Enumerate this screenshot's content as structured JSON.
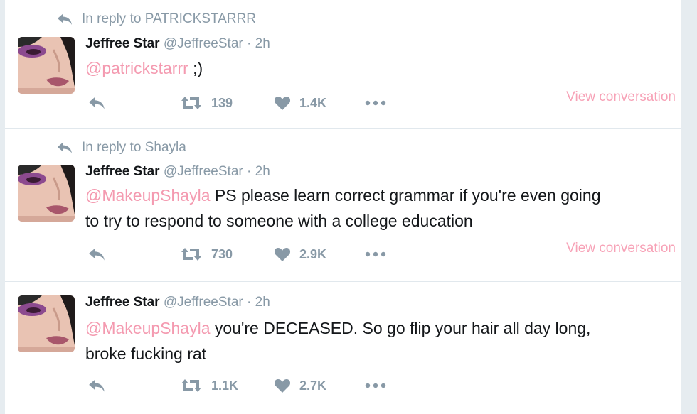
{
  "tweets": [
    {
      "context": "In reply to PATRICKSTARRR",
      "fullname": "Jeffree Star",
      "handle": "@JeffreeStar",
      "time": "· 2h",
      "mention": "@patrickstarrr",
      "text": " ;)",
      "text_line2": "",
      "retweets": "139",
      "likes": "1.4K",
      "view_conversation": "View conversation"
    },
    {
      "context": "In reply to Shayla",
      "fullname": "Jeffree Star",
      "handle": "@JeffreeStar",
      "time": "· 2h",
      "mention": "@MakeupShayla",
      "text": " PS please learn correct grammar if you're even going",
      "text_line2": "to try to respond to someone with a college education",
      "retweets": "730",
      "likes": "2.9K",
      "view_conversation": "View conversation"
    },
    {
      "context": "",
      "fullname": "Jeffree Star",
      "handle": "@JeffreeStar",
      "time": "· 2h",
      "mention": "@MakeupShayla",
      "text": " you're DECEASED. So go flip your hair all day long,",
      "text_line2": "broke fucking rat",
      "retweets": "1.1K",
      "likes": "2.7K",
      "view_conversation": ""
    }
  ],
  "colors": {
    "mention": "#f49ab0",
    "view_conversation": "#f7a1b6",
    "muted": "#8899a6",
    "divider": "#e1e8ed"
  },
  "icons": [
    "reply-icon",
    "retweet-icon",
    "heart-icon",
    "more-icon",
    "in-reply-arrow-icon"
  ]
}
